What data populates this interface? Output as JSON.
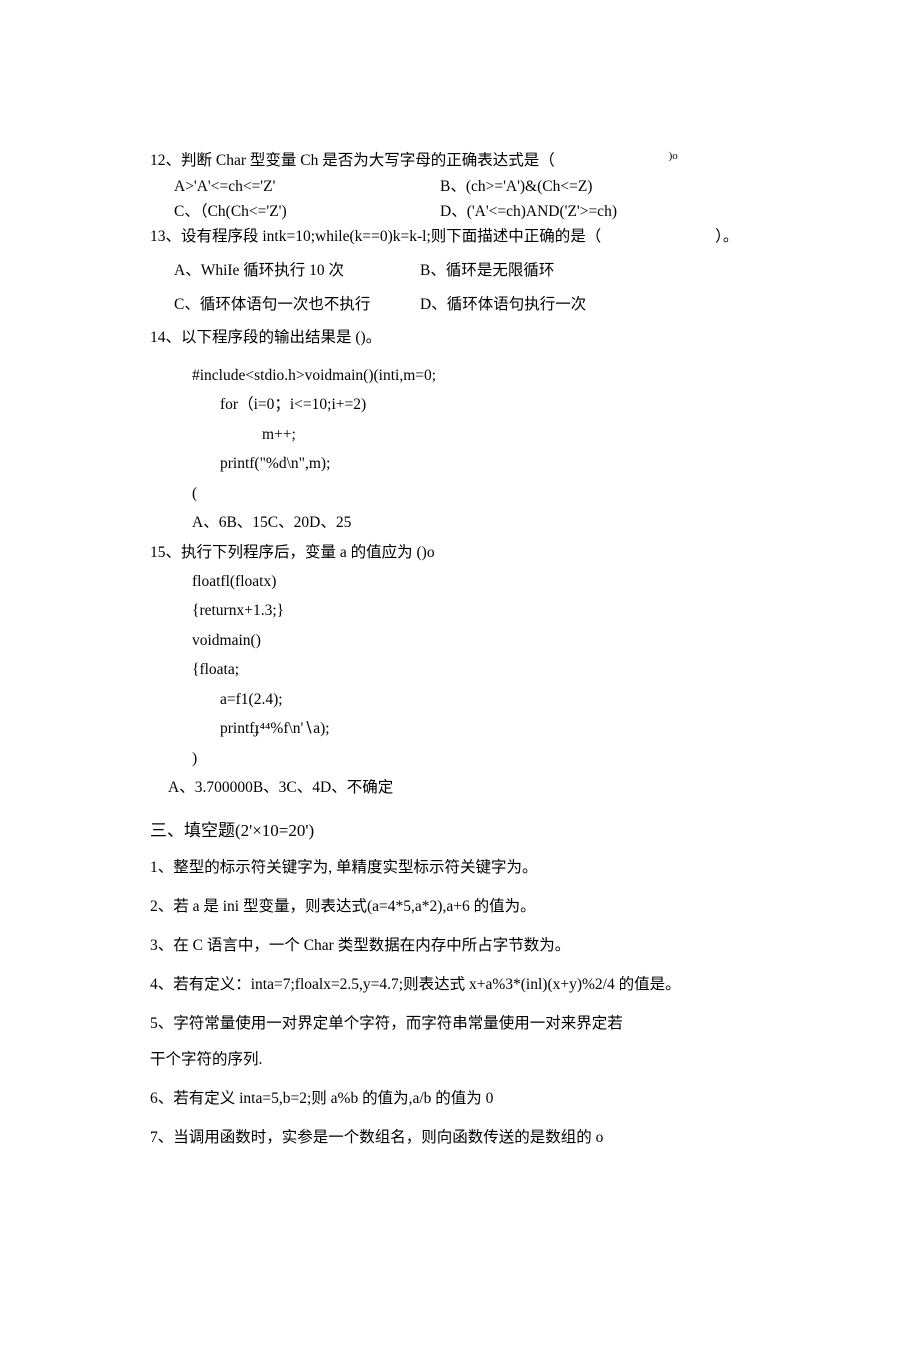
{
  "q12": {
    "stem": "12、判断 Char 型变量 Ch 是否为大写字母的正确表达式是（",
    "stem_tail": ")o",
    "optA": "A>'A'<=ch<='Z'",
    "optB": "B、(ch>='A')&(Ch<=Z)",
    "optC": "C、（Ch(Ch<='Z')",
    "optD": "D、('A'<=ch)AND('Z'>=ch)"
  },
  "q13": {
    "stem": "13、设有程序段 intk=10;while(k==0)k=k-l;则下面描述中正确的是（",
    "stem_tail": "）。",
    "optA": "A、WhiIe 循环执行 10 次",
    "optB": "B、循环是无限循环",
    "optC": "C、循环体语句一次也不执行",
    "optD": "D、循环体语句执行一次"
  },
  "q14": {
    "stem": "14、以下程序段的输出结果是 ()。",
    "c1": "#include<stdio.h>voidmain()(inti,m=0;",
    "c2": "for（i=0；i<=10;i+=2)",
    "c3": "m++;",
    "c4": "printf(\"%d\\n\",m);",
    "c5": "(",
    "opts": "A、6B、15C、20D、25"
  },
  "q15": {
    "stem": "15、执行下列程序后，变量 a 的值应为 ()o",
    "c1": "floatfl(floatx)",
    "c2": "{returnx+1.3;}",
    "c3": "voidmain()",
    "c4": "{floata;",
    "c5": "a=f1(2.4);",
    "c6": "printfɟ⁴⁴%f\\n'∖a);",
    "c7": ")",
    "opts": "A、3.700000B、3C、4D、不确定"
  },
  "section3": {
    "heading": "三、填空题(2'×10=20')",
    "f1": "1、整型的标示符关键字为, 单精度实型标示符关键字为。",
    "f2": "2、若 a 是 ini 型变量，则表达式(a=4*5,a*2),a+6 的值为。",
    "f3": "3、在 C 语言中，一个 Char 类型数据在内存中所占字节数为。",
    "f4": "4、若有定义：inta=7;floalx=2.5,y=4.7;则表达式 x+a%3*(inl)(x+y)%2/4 的值是。",
    "f5a": "5、字符常量使用一对界定单个字符，而字符串常量使用一对来界定若",
    "f5b": "干个字符的序列.",
    "f6": "6、若有定义 inta=5,b=2;则 a%b 的值为,a/b 的值为 0",
    "f7": "7、当调用函数时，实参是一个数组名，则向函数传送的是数组的 o"
  }
}
